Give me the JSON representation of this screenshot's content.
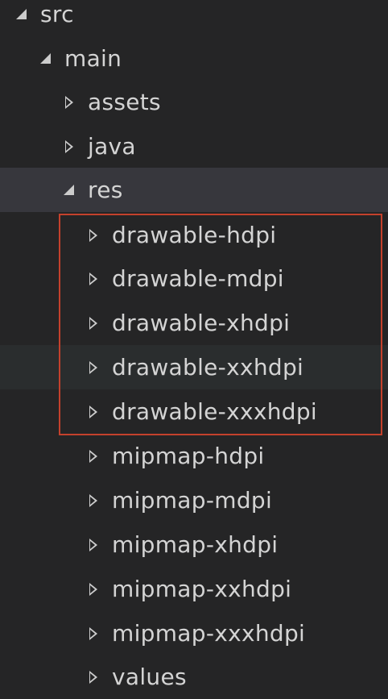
{
  "tree": {
    "items": [
      {
        "label": "src",
        "expanded": true,
        "icon": "chevron-down-icon"
      },
      {
        "label": "main",
        "expanded": true,
        "icon": "chevron-down-icon"
      },
      {
        "label": "assets",
        "expanded": false,
        "icon": "chevron-right-icon"
      },
      {
        "label": "java",
        "expanded": false,
        "icon": "chevron-right-icon"
      },
      {
        "label": "res",
        "expanded": true,
        "icon": "chevron-down-icon",
        "selected": true
      },
      {
        "label": "drawable-hdpi",
        "expanded": false,
        "icon": "chevron-right-icon"
      },
      {
        "label": "drawable-mdpi",
        "expanded": false,
        "icon": "chevron-right-icon"
      },
      {
        "label": "drawable-xhdpi",
        "expanded": false,
        "icon": "chevron-right-icon"
      },
      {
        "label": "drawable-xxhdpi",
        "expanded": false,
        "icon": "chevron-right-icon",
        "hovered": true
      },
      {
        "label": "drawable-xxxhdpi",
        "expanded": false,
        "icon": "chevron-right-icon"
      },
      {
        "label": "mipmap-hdpi",
        "expanded": false,
        "icon": "chevron-right-icon"
      },
      {
        "label": "mipmap-mdpi",
        "expanded": false,
        "icon": "chevron-right-icon"
      },
      {
        "label": "mipmap-xhdpi",
        "expanded": false,
        "icon": "chevron-right-icon"
      },
      {
        "label": "mipmap-xxhdpi",
        "expanded": false,
        "icon": "chevron-right-icon"
      },
      {
        "label": "mipmap-xxxhdpi",
        "expanded": false,
        "icon": "chevron-right-icon"
      },
      {
        "label": "values",
        "expanded": false,
        "icon": "chevron-right-icon"
      }
    ]
  },
  "colors": {
    "background": "#252526",
    "selected_row": "#37373d",
    "hover_row": "#2a2d2e",
    "text": "#d4d4d4",
    "highlight_border": "#c4412c"
  }
}
